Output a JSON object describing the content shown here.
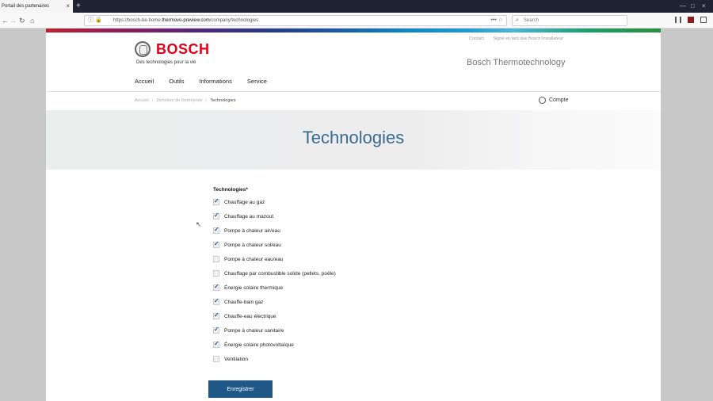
{
  "browser": {
    "tab_title": "Portail des partenaires",
    "tab_close": "×",
    "new_tab": "+",
    "url_prefix": "https://bosch-be-home.",
    "url_host": "thermovo-preview.com",
    "url_path": "/company/technologies",
    "url_more": "•••",
    "search_placeholder": "Search",
    "window_controls": [
      "—",
      "□",
      "×"
    ]
  },
  "site": {
    "brand": "BOSCH",
    "tagline": "Des technologies pour la vie",
    "top_links": [
      "Contact",
      "Signé en tant que Bosch Installateur"
    ],
    "brand_right": "Bosch Thermotechnology",
    "nav": [
      "Accueil",
      "Outils",
      "Informations",
      "Service"
    ],
    "breadcrumb": [
      "Accueil",
      "Données de l'entreprise",
      "Technologies"
    ],
    "breadcrumb_sep": "›",
    "account_label": "Compte",
    "page_title": "Technologies"
  },
  "form": {
    "label": "Technologies*",
    "options": [
      {
        "label": "Chauffage au gaz",
        "checked": true
      },
      {
        "label": "Chauffage au mazout",
        "checked": true
      },
      {
        "label": "Pompe à chaleur air/eau",
        "checked": true
      },
      {
        "label": "Pompe à chaleur sol/eau",
        "checked": true
      },
      {
        "label": "Pompe à chaleur eau/eau",
        "checked": false
      },
      {
        "label": "Chauffage par combustible solide (pellets, poêle)",
        "checked": false
      },
      {
        "label": "Énergie solaire thermique",
        "checked": true
      },
      {
        "label": "Chauffe-bain gaz",
        "checked": true
      },
      {
        "label": "Chauffe-eau électrique",
        "checked": true
      },
      {
        "label": "Pompe à chaleur sanitaire",
        "checked": true
      },
      {
        "label": "Énergie solaire photovoltaïque",
        "checked": true
      },
      {
        "label": "Ventilation",
        "checked": false
      }
    ],
    "submit_label": "Enregistrer"
  }
}
